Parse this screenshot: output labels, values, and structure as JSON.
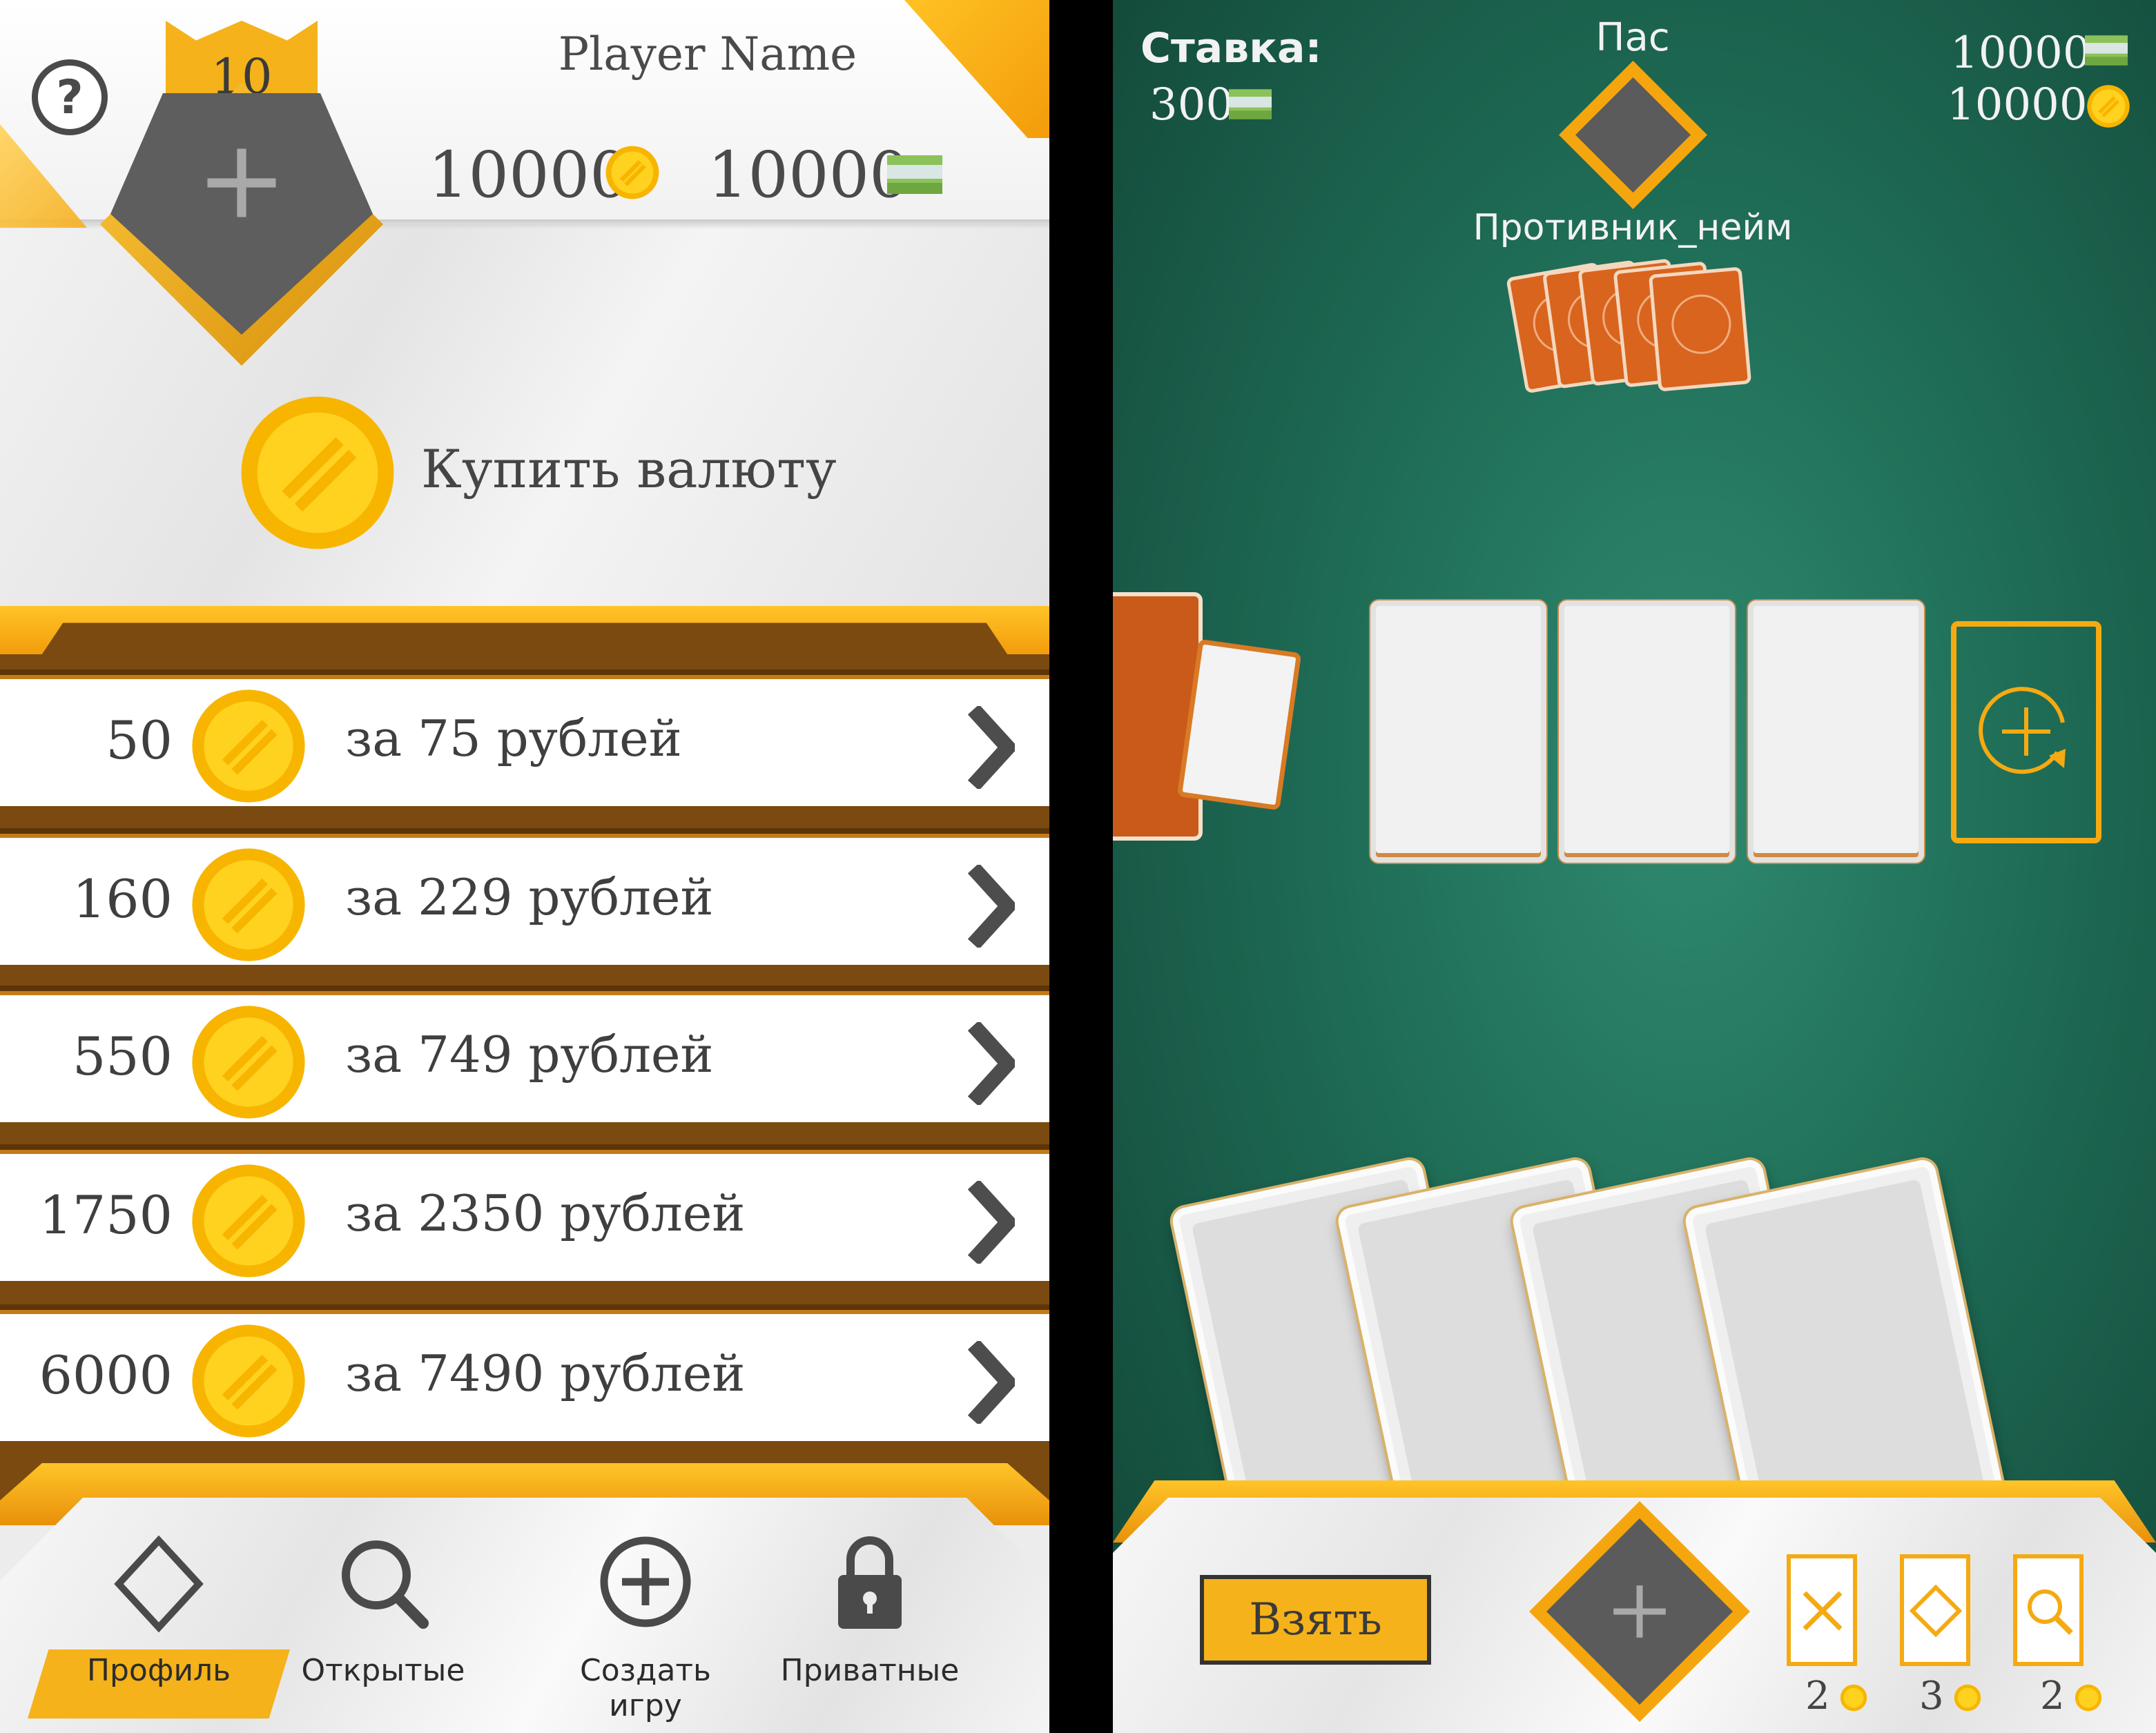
{
  "colors": {
    "gold": "#f5b21a",
    "dark_gray": "#5e5e5e",
    "table_green": "#1e6b55",
    "brown": "#7a4a10"
  },
  "profile": {
    "help_icon": "question-icon",
    "level": "10",
    "player_name": "Player Name",
    "coins": "10000",
    "cash": "10000",
    "buy_label": "Купить валюту"
  },
  "offers": [
    {
      "amount": "50",
      "price": "за 75 рублей"
    },
    {
      "amount": "160",
      "price": "за 229 рублей"
    },
    {
      "amount": "550",
      "price": "за 749 рублей"
    },
    {
      "amount": "1750",
      "price": "за 2350 рублей"
    },
    {
      "amount": "6000",
      "price": "за 7490 рублей"
    }
  ],
  "nav": [
    {
      "label": "Профиль",
      "icon": "diamond-icon",
      "active": true
    },
    {
      "label": "Открытые",
      "icon": "search-icon"
    },
    {
      "label": "Создать игру",
      "icon": "plus-circle-icon"
    },
    {
      "label": "Приватные",
      "icon": "lock-icon"
    }
  ],
  "game": {
    "bet_label": "Ставка:",
    "bet_value": "300",
    "opponent_status": "Пас",
    "opponent_name": "Противник_нейм",
    "player_cash": "10000",
    "player_coins": "10000",
    "take_button": "Взять",
    "powerups": [
      {
        "icon": "cross-icon",
        "count": "2"
      },
      {
        "icon": "diamond-icon",
        "count": "3"
      },
      {
        "icon": "search-icon",
        "count": "2"
      }
    ]
  }
}
